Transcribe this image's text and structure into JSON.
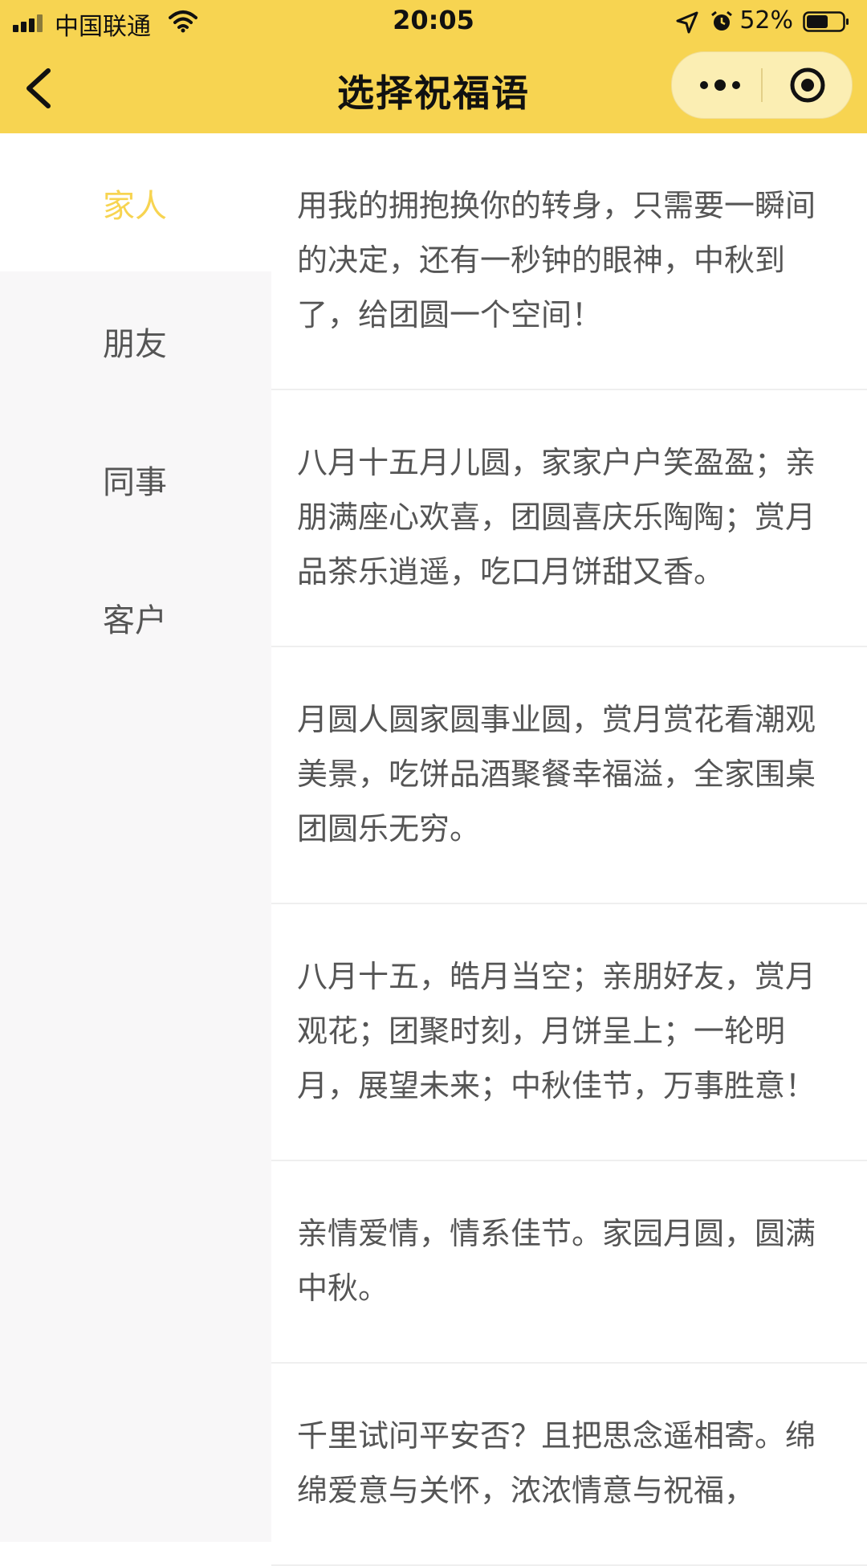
{
  "status_bar": {
    "carrier": "中国联通",
    "time": "20:05",
    "battery": "52%"
  },
  "nav": {
    "title": "选择祝福语"
  },
  "sidebar": {
    "items": [
      {
        "label": "家人",
        "active": true
      },
      {
        "label": "朋友",
        "active": false
      },
      {
        "label": "同事",
        "active": false
      },
      {
        "label": "客户",
        "active": false
      }
    ]
  },
  "messages": [
    "用我的拥抱换你的转身，只需要一瞬间的决定，还有一秒钟的眼神，中秋到了，给团圆一个空间！",
    "八月十五月儿圆，家家户户笑盈盈；亲朋满座心欢喜，团圆喜庆乐陶陶；赏月品茶乐逍遥，吃口月饼甜又香。",
    "月圆人圆家圆事业圆，赏月赏花看潮观美景，吃饼品酒聚餐幸福溢，全家围桌团圆乐无穷。",
    "八月十五，皓月当空；亲朋好友，赏月观花；团聚时刻，月饼呈上；一轮明月，展望未来；中秋佳节，万事胜意！",
    "亲情爱情，情系佳节。家园月圆，圆满中秋。",
    "千里试问平安否？且把思念遥相寄。绵绵爱意与关怀，浓浓情意与祝福，"
  ],
  "colors": {
    "accent": "#f7d451",
    "capsule": "#fbeeb3",
    "sidebar_bg": "#f8f7f8",
    "text": "#555555"
  }
}
